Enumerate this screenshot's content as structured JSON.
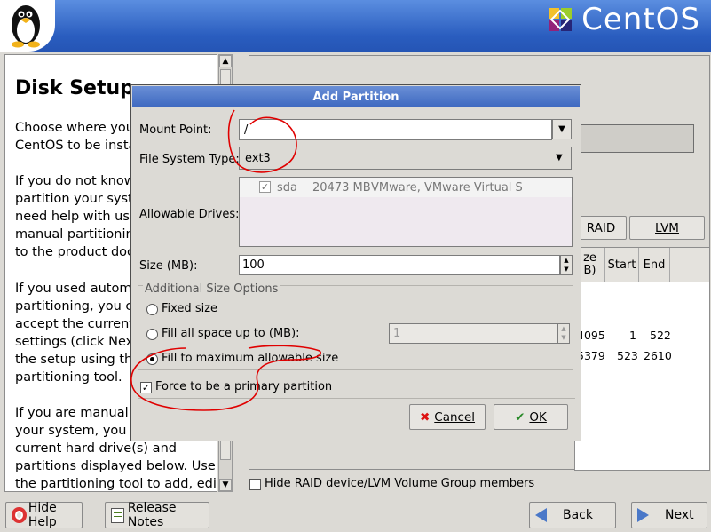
{
  "brand": {
    "name": "CentOS"
  },
  "help": {
    "title": "Disk Setup",
    "paragraphs": [
      [
        "Choose where you",
        "CentOS to be insta"
      ],
      [
        "If you do not know",
        "partition your syste",
        "need help with usi",
        "manual partitioning",
        "to the product docu"
      ],
      [
        "If you used automa",
        "partitioning, you ca",
        "accept the current",
        "settings (click Nex",
        "the setup using the",
        "partitioning tool."
      ],
      [
        "If you are manually",
        "your system, you c",
        "current hard drive(s) and",
        "partitions displayed below. Use",
        "the partitioning tool to add, edit,"
      ]
    ]
  },
  "right": {
    "raid_label": "RAID",
    "lvm_label": "LVM",
    "columns": [
      "ze\nB)",
      "Start",
      "End"
    ],
    "rows": [
      {
        "size": "4095",
        "start": "1",
        "end": "522"
      },
      {
        "size": "5379",
        "start": "523",
        "end": "2610"
      }
    ],
    "hide_raid_label": "Hide RAID device/LVM Volume Group members",
    "hide_raid_checked": false
  },
  "bottom": {
    "hide_help": "Hide Help",
    "release_notes": "Release Notes",
    "back": "Back",
    "next": "Next"
  },
  "dialog": {
    "title": "Add Partition",
    "mount_point_label": "Mount Point:",
    "mount_point_value": "/",
    "fs_type_label": "File System Type:",
    "fs_type_value": "ext3",
    "drives_label": "Allowable Drives:",
    "drive": {
      "checked": true,
      "name": "sda",
      "size": "20473 MB",
      "model": "VMware, VMware Virtual S"
    },
    "size_label": "Size (MB):",
    "size_value": "100",
    "size_options_label": "Additional Size Options",
    "opt_fixed": "Fixed size",
    "opt_fill_upto": "Fill all space up to (MB):",
    "opt_fill_upto_value": "1",
    "opt_fill_max": "Fill to maximum allowable size",
    "selected_option": "fill_max",
    "force_primary_label": "Force to be a primary partition",
    "force_primary_checked": true,
    "cancel": "Cancel",
    "ok": "OK"
  },
  "colors": {
    "header": "#2f66c7",
    "annotation": "#e00000"
  }
}
